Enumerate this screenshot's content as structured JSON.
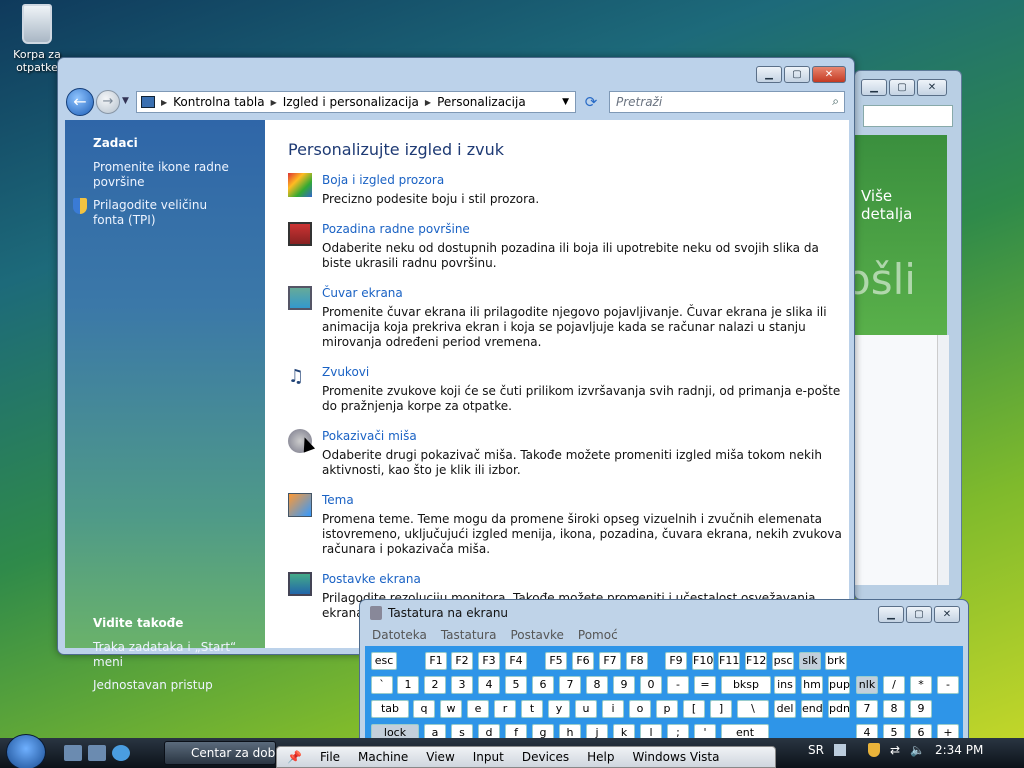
{
  "desktop": {
    "recycle_bin_label": "Korpa za otpatke"
  },
  "back_window": {
    "promo_text": "Više detalja",
    "big_text": "ošli"
  },
  "explorer": {
    "breadcrumb": [
      "Kontrolna tabla",
      "Izgled i personalizacija",
      "Personalizacija"
    ],
    "search_placeholder": "Pretraži",
    "sidebar": {
      "tasks_header": "Zadaci",
      "tasks": [
        "Promenite ikone radne površine",
        "Prilagodite veličinu fonta (TPI)"
      ],
      "see_also_header": "Vidite takođe",
      "see_also": [
        "Traka zadataka i „Start“ meni",
        "Jednostavan pristup"
      ]
    },
    "heading": "Personalizujte izgled i zvuk",
    "items": [
      {
        "title": "Boja i izgled prozora",
        "desc": "Precizno podesite boju i stil prozora."
      },
      {
        "title": "Pozadina radne površine",
        "desc": "Odaberite neku od dostupnih pozadina ili boja ili upotrebite neku od svojih slika da biste ukrasili radnu površinu."
      },
      {
        "title": "Čuvar ekrana",
        "desc": "Promenite čuvar ekrana ili prilagodite njegovo pojavljivanje. Čuvar ekrana je slika ili animacija koja prekriva ekran i koja se pojavljuje kada se računar nalazi u stanju mirovanja određeni period vremena."
      },
      {
        "title": "Zvukovi",
        "desc": "Promenite zvukove koji će se čuti prilikom izvršavanja svih radnji, od primanja e-pošte do pražnjenja korpe za otpatke."
      },
      {
        "title": "Pokazivači miša",
        "desc": "Odaberite drugi pokazivač miša. Takođe možete promeniti izgled miša tokom nekih aktivnosti, kao što je klik ili izbor."
      },
      {
        "title": "Tema",
        "desc": "Promena teme. Teme mogu da promene široki opseg vizuelnih i zvučnih elemenata istovremeno, uključujući izgled menija, ikona, pozadina, čuvara ekrana, nekih zvukova računara i pokazivača miša."
      },
      {
        "title": "Postavke ekrana",
        "desc": "Prilagodite rezoluciju monitora. Takođe možete promeniti i učestalost osvežavanja ekrana. Možete"
      }
    ]
  },
  "osk": {
    "title": "Tastatura na ekranu",
    "menu": [
      "Datoteka",
      "Tastatura",
      "Postavke",
      "Pomoć"
    ],
    "row1": [
      "esc",
      "F1",
      "F2",
      "F3",
      "F4",
      "F5",
      "F6",
      "F7",
      "F8",
      "F9",
      "F10",
      "F11",
      "F12",
      "psc",
      "slk",
      "brk"
    ],
    "row2": [
      "`",
      "1",
      "2",
      "3",
      "4",
      "5",
      "6",
      "7",
      "8",
      "9",
      "0",
      "-",
      "=",
      "bksp",
      "ins",
      "hm",
      "pup",
      "nlk",
      "/",
      "*",
      "-"
    ],
    "row3": [
      "tab",
      "q",
      "w",
      "e",
      "r",
      "t",
      "y",
      "u",
      "i",
      "o",
      "p",
      "[",
      "]",
      "\\",
      "del",
      "end",
      "pdn",
      "7",
      "8",
      "9"
    ],
    "row4": [
      "lock",
      "a",
      "s",
      "d",
      "f",
      "g",
      "h",
      "j",
      "k",
      "l",
      ";",
      "'",
      "ent",
      "4",
      "5",
      "6",
      "+"
    ]
  },
  "taskbar": {
    "task_label": "Centar za dobro",
    "lang": "SR",
    "clock": "2:34 PM"
  },
  "vm_bar": {
    "menu": [
      "File",
      "Machine",
      "View",
      "Input",
      "Devices",
      "Help"
    ],
    "os_label": "Windows Vista"
  }
}
